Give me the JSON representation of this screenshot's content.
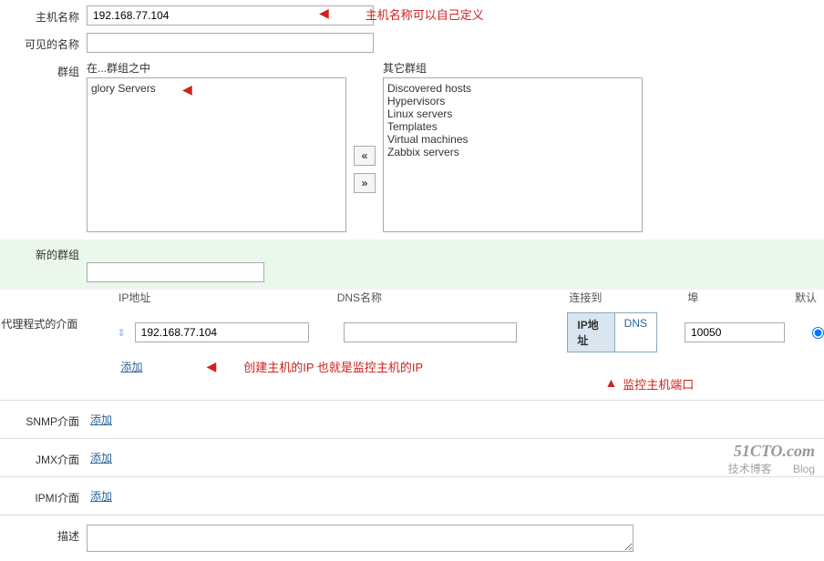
{
  "labels": {
    "hostName": "主机名称",
    "visibleName": "可见的名称",
    "groups": "群组",
    "inGroups": "在...群组之中",
    "otherGroups": "其它群组",
    "newGroup": "新的群组",
    "proxyIface": "代理程式的介面",
    "ipAddr": "IP地址",
    "dnsName": "DNS名称",
    "connectTo": "连接到",
    "port": "埠",
    "default": "默认",
    "snmpIface": "SNMP介面",
    "jmxIface": "JMX介面",
    "ipmiIface": "IPMI介面",
    "description": "描述",
    "add": "添加",
    "btnIp": "IP地址",
    "btnDns": "DNS"
  },
  "values": {
    "hostName": "192.168.77.104",
    "visibleName": "",
    "newGroup": "",
    "agentIp": "192.168.77.104",
    "agentDns": "",
    "agentPort": "10050"
  },
  "lists": {
    "inGroups": [
      "glory Servers"
    ],
    "otherGroups": [
      "Discovered hosts",
      "Hypervisors",
      "Linux servers",
      "Templates",
      "Virtual machines",
      "Zabbix servers"
    ]
  },
  "annotations": {
    "hostNameNote": "主机名称可以自己定义",
    "ipNote": "创建主机的IP 也就是监控主机的IP",
    "portNote": "监控主机端口"
  },
  "watermark": {
    "domain": "51CTO.com",
    "sub": "技术博客",
    "tag": "Blog"
  }
}
